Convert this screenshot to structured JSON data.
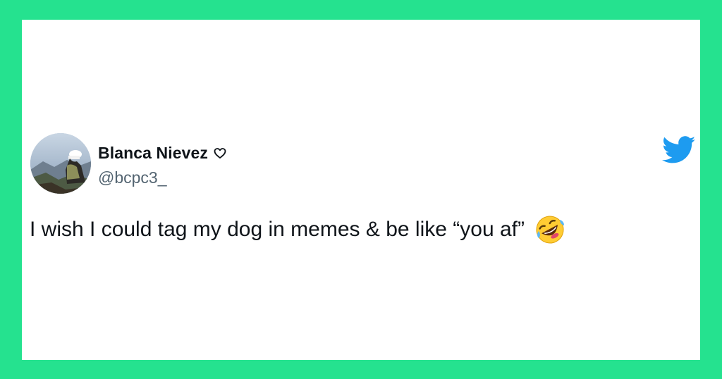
{
  "colors": {
    "frame": "#25e28f",
    "card": "#ffffff",
    "twitter_blue": "#1d9bf0",
    "text": "#0f1419",
    "secondary_text": "#536471"
  },
  "tweet": {
    "author": {
      "display_name": "Blanca Nievez",
      "handle": "@bcpc3_",
      "avatar_icon": "profile-photo",
      "name_badge_icon": "heart-outline-icon"
    },
    "brand_icon": "twitter-bird-icon",
    "text": "I wish I could tag my dog in memes & be like “you af”",
    "emoji": "rolling-on-floor-laughing-emoji"
  }
}
